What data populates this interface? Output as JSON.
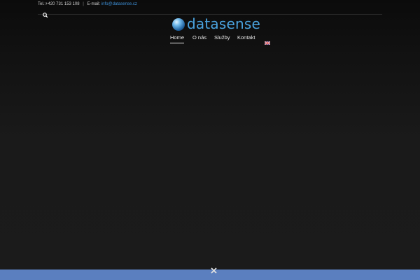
{
  "topbar": {
    "phone": "Tel.:+420 731 153 108",
    "separator": "|",
    "email_label": "E-mail:",
    "email": "info@datasense.cz"
  },
  "header": {
    "search_icon": "search-icon",
    "logo_text": "datasense",
    "logo_icon": "globe-icon"
  },
  "nav": {
    "items": [
      {
        "label": "Home",
        "active": true
      },
      {
        "label": "O nás",
        "active": false
      },
      {
        "label": "Služby",
        "active": false
      },
      {
        "label": "Kontakt",
        "active": false
      }
    ],
    "language_icon": "uk-flag-icon"
  },
  "footer": {
    "close_icon": "close-icon"
  },
  "colors": {
    "accent": "#4aa3df",
    "email_link": "#3d8fd6",
    "banner": "#5b7fbf"
  }
}
